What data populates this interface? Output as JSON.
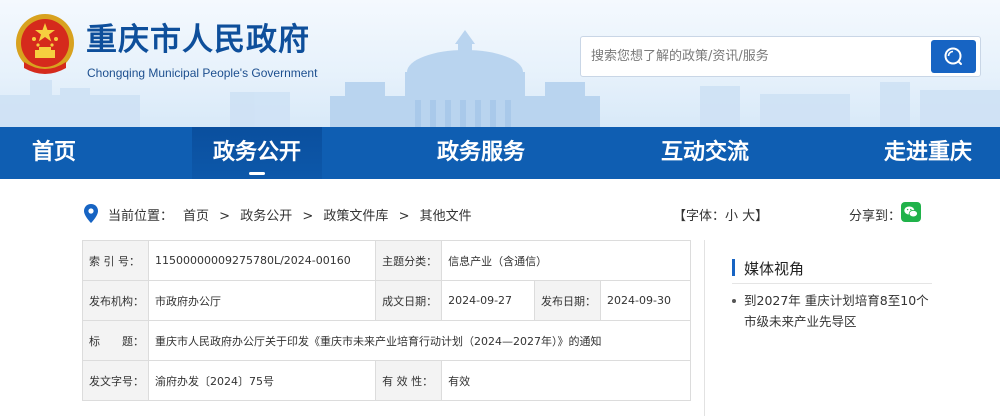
{
  "header": {
    "title": "重庆市人民政府",
    "subtitle": "Chongqing Municipal People's Government",
    "search": {
      "placeholder": "搜索您想了解的政策/资讯/服务"
    }
  },
  "nav": {
    "items": [
      {
        "label": "首页"
      },
      {
        "label": "政务公开"
      },
      {
        "label": "政务服务"
      },
      {
        "label": "互动交流"
      },
      {
        "label": "走进重庆"
      }
    ],
    "active_index": 1
  },
  "breadcrumb": {
    "prefix": "当前位置：",
    "items": [
      "首页",
      "政务公开",
      "政策文件库",
      "其他文件"
    ],
    "separator": ">",
    "font_control": "【字体：小 大】",
    "share_label": "分享到："
  },
  "info": {
    "labels": {
      "index": "索 引 号：",
      "topic": "主题分类：",
      "issuer": "发布机构：",
      "written_date": "成文日期：",
      "publish_date": "发布日期：",
      "title": "标　　题：",
      "doc_no": "发文字号：",
      "validity": "有 效 性："
    },
    "values": {
      "index": "11500000009275780L/2024-00160",
      "topic": "信息产业（含通信）",
      "issuer": "市政府办公厅",
      "written_date": "2024-09-27",
      "publish_date": "2024-09-30",
      "title": "重庆市人民政府办公厅关于印发《重庆市未来产业培育行动计划（2024—2027年）》的通知",
      "doc_no": "渝府办发〔2024〕75号",
      "validity": "有效"
    }
  },
  "sidebar": {
    "title": "媒体视角",
    "items": [
      "到2027年 重庆计划培育8至10个市级未来产业先导区"
    ]
  },
  "colors": {
    "brand_blue": "#0f5eb2",
    "title_blue": "#0e4f9b",
    "search_button": "#1764c3",
    "wechat_green": "#20b24a"
  }
}
